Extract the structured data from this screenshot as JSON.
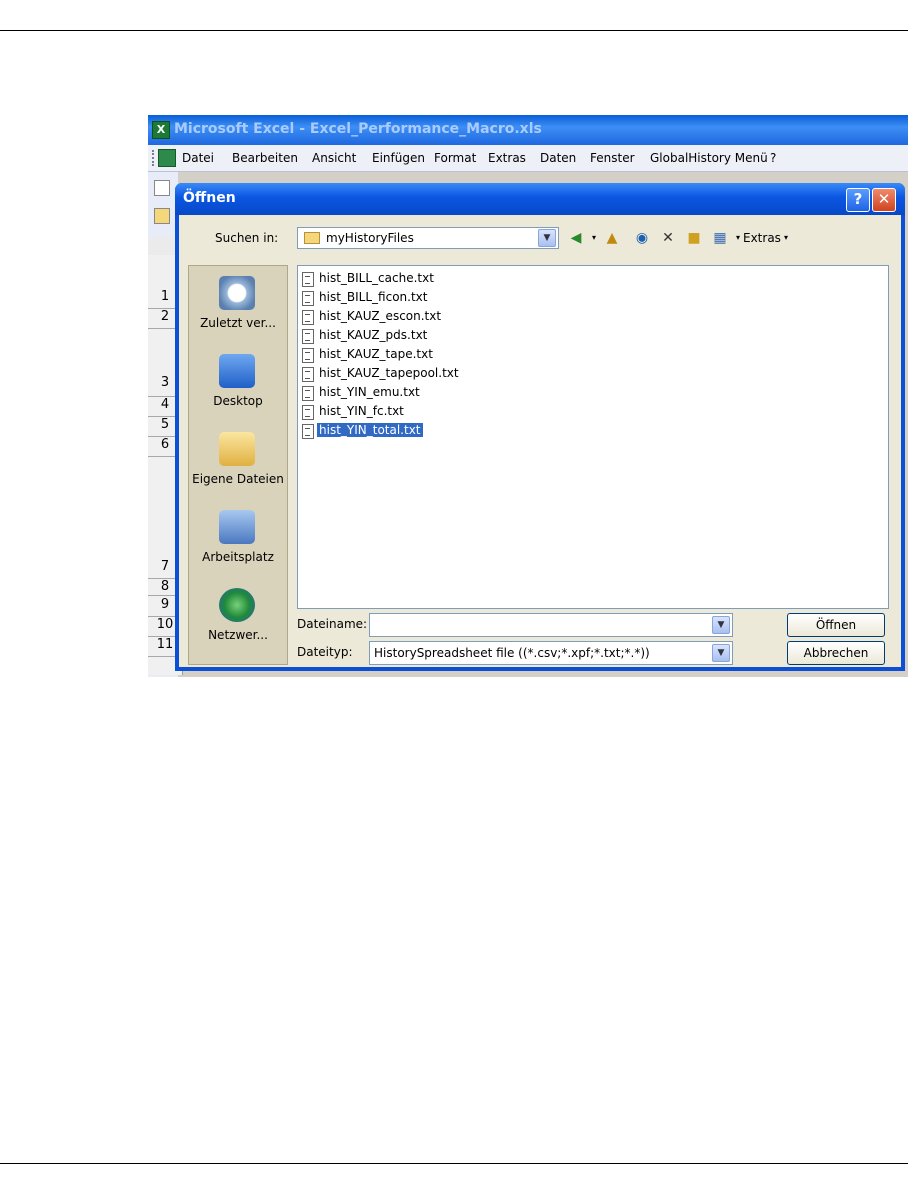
{
  "excel": {
    "title": "Microsoft Excel - Excel_Performance_Macro.xls",
    "menu": [
      "Datei",
      "Bearbeiten",
      "Ansicht",
      "Einfügen",
      "Format",
      "Extras",
      "Daten",
      "Fenster",
      "GlobalHistory Menü",
      "?"
    ],
    "row_numbers": [
      "1",
      "2",
      "3",
      "4",
      "5",
      "6",
      "7",
      "8",
      "9",
      "10",
      "11"
    ]
  },
  "dialog": {
    "title": "Öffnen",
    "look_in_label": "Suchen in:",
    "look_in_value": "myHistoryFiles",
    "extras_label": "Extras",
    "places": [
      "Zuletzt ver...",
      "Desktop",
      "Eigene Dateien",
      "Arbeitsplatz",
      "Netzwer..."
    ],
    "files": [
      "hist_BILL_cache.txt",
      "hist_BILL_ficon.txt",
      "hist_KAUZ_escon.txt",
      "hist_KAUZ_pds.txt",
      "hist_KAUZ_tape.txt",
      "hist_KAUZ_tapepool.txt",
      "hist_YIN_emu.txt",
      "hist_YIN_fc.txt",
      "hist_YIN_total.txt"
    ],
    "selected_file": "hist_YIN_total.txt",
    "filename_label": "Dateiname:",
    "filename_value": "",
    "filetype_label": "Dateityp:",
    "filetype_value": "HistorySpreadsheet file ((*.csv;*.xpf;*.txt;*.*))",
    "open_button": "Öffnen",
    "cancel_button": "Abbrechen"
  }
}
